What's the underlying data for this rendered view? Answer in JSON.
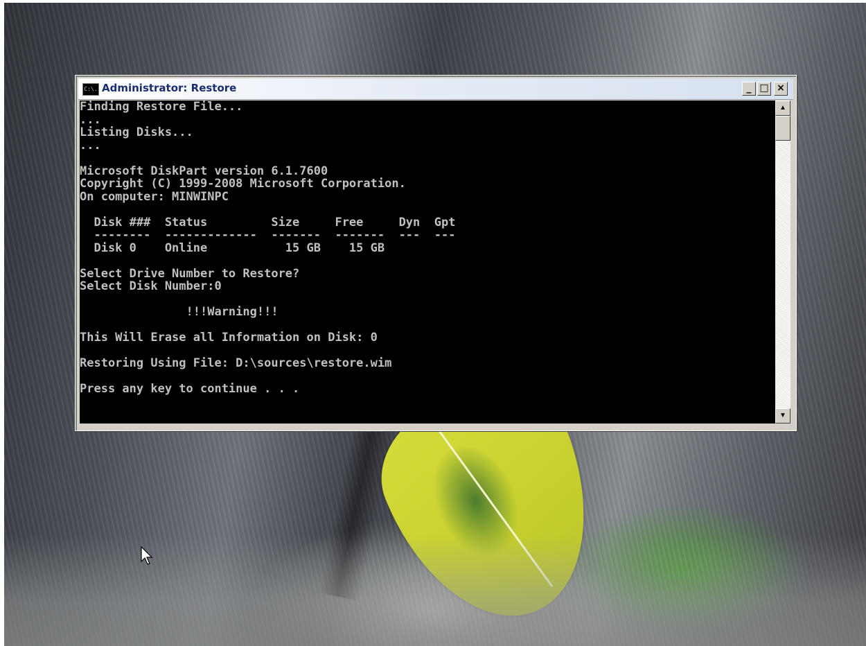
{
  "window": {
    "title": "Administrator: Restore",
    "icon_text": "C:\\.",
    "minimize_glyph": "_",
    "maximize_glyph": "□",
    "close_glyph": "×",
    "scroll_up_glyph": "▲",
    "scroll_down_glyph": "▼"
  },
  "console": {
    "lines": [
      "Finding Restore File...",
      "...",
      "Listing Disks...",
      "...",
      "",
      "Microsoft DiskPart version 6.1.7600",
      "Copyright (C) 1999-2008 Microsoft Corporation.",
      "On computer: MINWINPC",
      "",
      "  Disk ###  Status         Size     Free     Dyn  Gpt",
      "  --------  -------------  -------  -------  ---  ---",
      "  Disk 0    Online           15 GB    15 GB",
      "",
      "Select Drive Number to Restore?",
      "Select Disk Number:0",
      "",
      "               !!!Warning!!!",
      "",
      "This Will Erase all Information on Disk: 0",
      "",
      "Restoring Using File: D:\\sources\\restore.wim",
      "",
      "Press any key to continue . . ."
    ]
  },
  "icons": {
    "cursor": "arrow-cursor-icon",
    "console_app": "console-app-icon"
  }
}
